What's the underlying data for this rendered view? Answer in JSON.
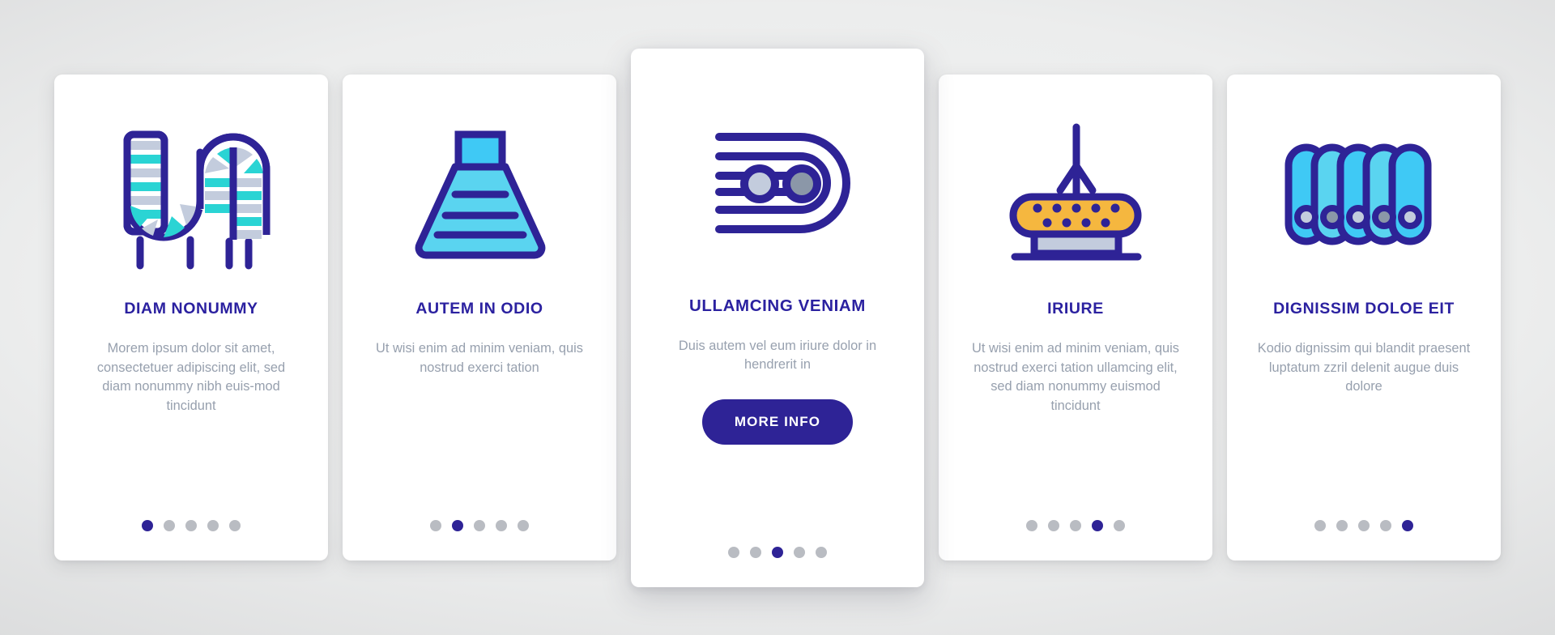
{
  "theme": {
    "primary": "#2e2396",
    "title_color": "#2b21a0",
    "body_color": "#97a0ae",
    "dot_inactive": "#b9bcc2",
    "cyan": "#2ad4d4",
    "light_blue": "#3fc9f5",
    "sky": "#5ad4f0",
    "steel": "#c3ccdd",
    "amber": "#f5b73f",
    "card_bg": "#ffffff"
  },
  "cards": [
    {
      "icon": "conveyor-coil-icon",
      "title": "DIAM NONUMMY",
      "body": "Morem ipsum dolor sit amet, consectetuer adipiscing elit, sed diam nonummy nibh euis-mod tincidunt",
      "dots": 5,
      "active_dot": 1,
      "featured": false,
      "cta": null
    },
    {
      "icon": "hopper-funnel-icon",
      "title": "AUTEM IN ODIO",
      "body": "Ut wisi enim ad minim veniam, quis nostrud exerci tation",
      "dots": 5,
      "active_dot": 2,
      "featured": false,
      "cta": null
    },
    {
      "icon": "belt-loop-rollers-icon",
      "title": "ULLAMCING VENIAM",
      "body": "Duis autem vel eum iriure dolor in hendrerit in",
      "dots": 5,
      "active_dot": 3,
      "featured": true,
      "cta": "MORE INFO"
    },
    {
      "icon": "robot-arm-conveyor-icon",
      "title": "IRIURE",
      "body": "Ut wisi enim ad minim veniam, quis nostrud exerci tation ullamcing elit, sed diam nonummy euismod tincidunt",
      "dots": 5,
      "active_dot": 4,
      "featured": false,
      "cta": null
    },
    {
      "icon": "roller-bank-icon",
      "title": "DIGNISSIM DOLOE EIT",
      "body": "Kodio dignissim qui blandit praesent luptatum zzril delenit augue duis dolore",
      "dots": 5,
      "active_dot": 5,
      "featured": false,
      "cta": null
    }
  ]
}
